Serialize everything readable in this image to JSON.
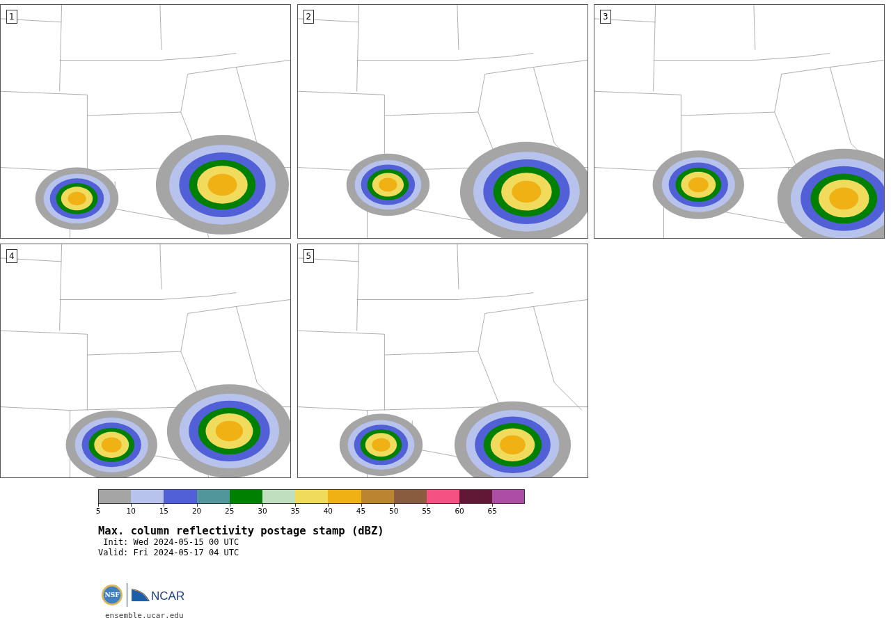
{
  "panels": [
    {
      "label": "1"
    },
    {
      "label": "2"
    },
    {
      "label": "3"
    },
    {
      "label": "4"
    },
    {
      "label": "5"
    }
  ],
  "colorbar": [
    {
      "label": "5",
      "color": "#a5a5a5"
    },
    {
      "label": "10",
      "color": "#b7c3ed"
    },
    {
      "label": "15",
      "color": "#5160d6"
    },
    {
      "label": "20",
      "color": "#50969b"
    },
    {
      "label": "25",
      "color": "#008000"
    },
    {
      "label": "30",
      "color": "#bfdfbf"
    },
    {
      "label": "35",
      "color": "#f0db5d"
    },
    {
      "label": "40",
      "color": "#f0b115"
    },
    {
      "label": "45",
      "color": "#bb8430"
    },
    {
      "label": "50",
      "color": "#8a5c3f"
    },
    {
      "label": "55",
      "color": "#f55182"
    },
    {
      "label": "60",
      "color": "#601836"
    },
    {
      "label": "65",
      "color": "#ae4da5"
    }
  ],
  "title": "Max. column reflectivity postage stamp (dBZ)",
  "init": " Init: Wed 2024-05-15 00 UTC",
  "valid": "Valid: Fri 2024-05-17 04 UTC",
  "logos": {
    "nsf": "NSF",
    "ncar": "NCAR"
  },
  "url": "ensemble.ucar.edu"
}
